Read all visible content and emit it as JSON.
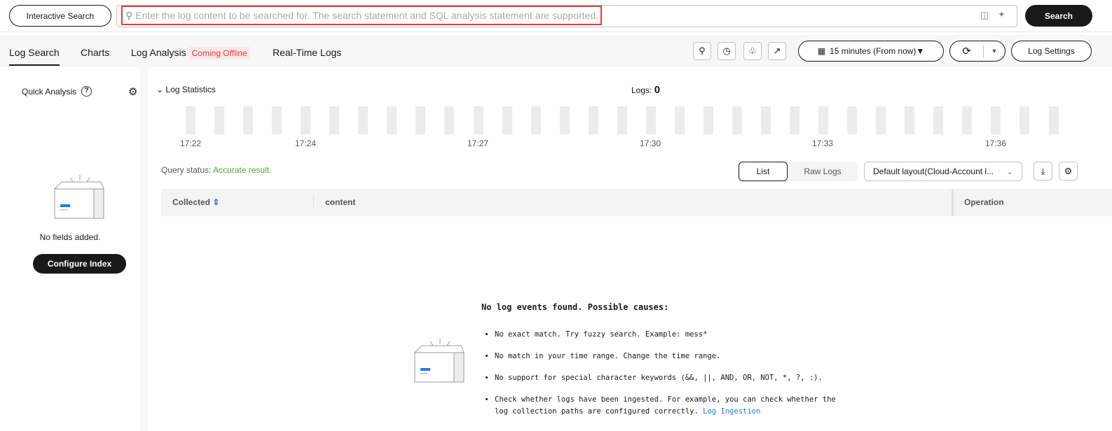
{
  "topbar": {
    "mode_button": "Interactive Search",
    "search_placeholder": "Enter the log content to be searched for. The search statement and SQL analysis statement are supported.",
    "search_button": "Search"
  },
  "tabs": [
    {
      "label": "Log Search"
    },
    {
      "label": "Charts"
    },
    {
      "label": "Log Analysis",
      "badge": "Coming Offline"
    },
    {
      "label": "Real-Time Logs"
    }
  ],
  "toolbar": {
    "time_range": "15 minutes (From now)▼",
    "log_settings": "Log Settings"
  },
  "sidebar": {
    "title": "Quick Analysis",
    "empty_text": "No fields added.",
    "configure_button": "Configure Index"
  },
  "stats": {
    "title": "Log Statistics",
    "logs_label": "Logs:",
    "logs_count": "0",
    "ticks": [
      "17:22",
      "17:24",
      "17:27",
      "17:30",
      "17:33",
      "17:36"
    ]
  },
  "query": {
    "status_label": "Query status:",
    "status_value": "Accurate result.",
    "view_list": "List",
    "view_raw": "Raw Logs",
    "layout": "Default layout(Cloud-Account l..."
  },
  "table": {
    "columns": [
      "Collected",
      "content",
      "Operation"
    ]
  },
  "empty": {
    "title": "No log events found. Possible causes:",
    "causes": [
      "No exact match. Try fuzzy search. Example: mess*",
      "No match in your time range. Change the time range.",
      "No support for special character keywords (&&, ||, AND, OR, NOT, *, ?, :).",
      "Check whether logs have been ingested. For example, you can check whether the log collection paths are configured correctly."
    ],
    "link": "Log Ingestion"
  },
  "colors": {
    "accent": "#526ecc",
    "success": "#50a830",
    "danger": "#e5393b"
  }
}
